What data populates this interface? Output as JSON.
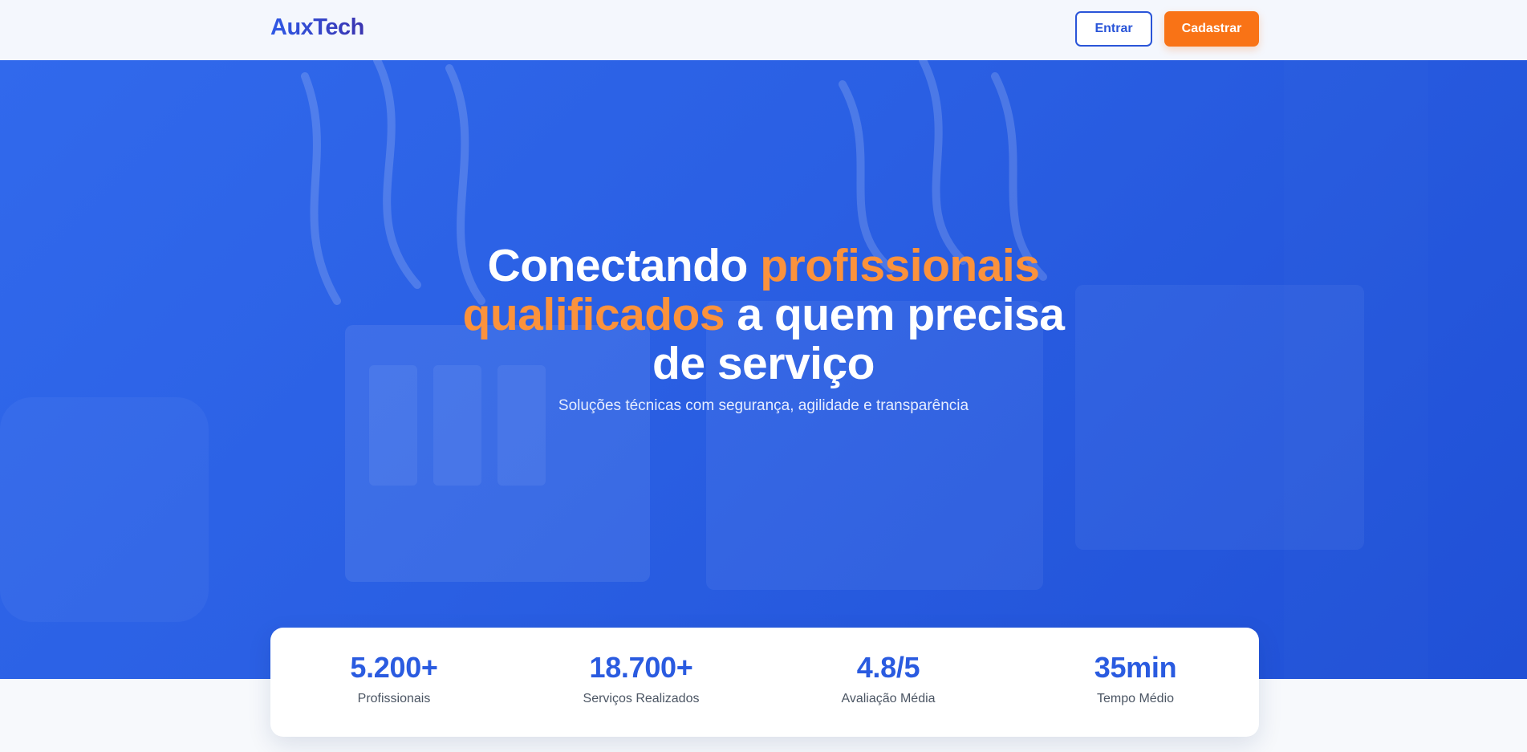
{
  "header": {
    "logo": "AuxTech",
    "login_label": "Entrar",
    "signup_label": "Cadastrar"
  },
  "hero": {
    "title_part1": "Conectando ",
    "title_accent1": "profissionais",
    "title_accent2": "qualificados",
    "title_part2": " a quem precisa",
    "title_part3": "de serviço",
    "subtitle": "Soluções técnicas com segurança, agilidade e transparência"
  },
  "stats": [
    {
      "value": "5.200+",
      "label": "Profissionais"
    },
    {
      "value": "18.700+",
      "label": "Serviços Realizados"
    },
    {
      "value": "4.8/5",
      "label": "Avaliação Média"
    },
    {
      "value": "35min",
      "label": "Tempo Médio"
    }
  ],
  "colors": {
    "primary": "#2a5be0",
    "accent": "#f97316",
    "hero_accent_text": "#fb923c"
  }
}
